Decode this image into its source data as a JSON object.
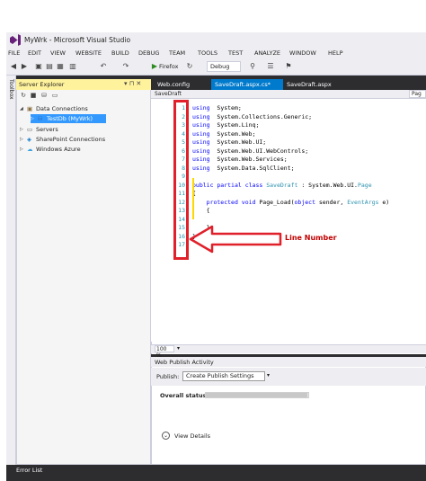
{
  "window": {
    "title": "MyWrk - Microsoft Visual Studio"
  },
  "menu": [
    "FILE",
    "EDIT",
    "VIEW",
    "WEBSITE",
    "BUILD",
    "DEBUG",
    "TEAM",
    "TOOLS",
    "TEST",
    "ANALYZE",
    "WINDOW",
    "HELP"
  ],
  "toolbar": {
    "browser": "Firefox",
    "config": "Debug"
  },
  "toolbox": {
    "label": "Toolbox"
  },
  "server_explorer": {
    "title": "Server Explorer",
    "pin": "▾ ⊓ ✕",
    "tree": [
      {
        "label": "Data Connections",
        "depth": 0,
        "expanded": true
      },
      {
        "label": "TestDb (MyWrk)",
        "depth": 1,
        "selected": true
      },
      {
        "label": "Servers",
        "depth": 0
      },
      {
        "label": "SharePoint Connections",
        "depth": 0
      },
      {
        "label": "Windows Azure",
        "depth": 0
      }
    ]
  },
  "tabs": [
    {
      "label": "Web.config"
    },
    {
      "label": "SaveDraft.aspx.cs*"
    },
    {
      "label": "SaveDraft.aspx"
    }
  ],
  "editor": {
    "nav_left": "SaveDraft",
    "nav_right": "Pag",
    "lines": [
      "1",
      "2",
      "3",
      "4",
      "5",
      "6",
      "7",
      "8",
      "9",
      "10",
      "11",
      "12",
      "13",
      "14",
      "15",
      "16",
      "17"
    ],
    "code": [
      [
        [
          "kw",
          "using"
        ],
        [
          "",
          "  System;"
        ]
      ],
      [
        [
          "kw",
          "using"
        ],
        [
          "",
          "  System.Collections.Generic;"
        ]
      ],
      [
        [
          "kw",
          "using"
        ],
        [
          "",
          "  System.Linq;"
        ]
      ],
      [
        [
          "kw",
          "using"
        ],
        [
          "",
          "  System.Web;"
        ]
      ],
      [
        [
          "kw",
          "using"
        ],
        [
          "",
          "  System.Web.UI;"
        ]
      ],
      [
        [
          "kw",
          "using"
        ],
        [
          "",
          "  System.Web.UI.WebControls;"
        ]
      ],
      [
        [
          "kw",
          "using"
        ],
        [
          "",
          "  System.Web.Services;"
        ]
      ],
      [
        [
          "kw",
          "using"
        ],
        [
          "",
          "  System.Data.SqlClient;"
        ]
      ],
      [],
      [
        [
          "kw",
          "public partial class"
        ],
        [
          "",
          " "
        ],
        [
          "ty",
          "SaveDraft"
        ],
        [
          "",
          " : System.Web.UI."
        ],
        [
          "ty",
          "Page"
        ]
      ],
      [
        [
          "",
          "{"
        ]
      ],
      [
        [
          "",
          "    "
        ],
        [
          "kw",
          "protected void"
        ],
        [
          "",
          " Page_Load("
        ],
        [
          "kw",
          "object"
        ],
        [
          "",
          " sender, "
        ],
        [
          "ty",
          "EventArgs"
        ],
        [
          "",
          " e)"
        ]
      ],
      [
        [
          "",
          "    {"
        ]
      ],
      [],
      [
        [
          "",
          "    }"
        ]
      ],
      [
        [
          "",
          "}"
        ]
      ],
      []
    ],
    "annotation": "Line Number",
    "zoom": "100 %"
  },
  "publish": {
    "title": "Web Publish Activity",
    "publish_label": "Publish:",
    "profile": "Create Publish Settings",
    "overall_status": "Overall status",
    "progress": 0.99,
    "view_details": "View Details"
  },
  "bottom": {
    "error_list": "Error List"
  },
  "colors": {
    "accent": "#68217a",
    "marker": "#e0202a",
    "selected": "#3399ff"
  }
}
